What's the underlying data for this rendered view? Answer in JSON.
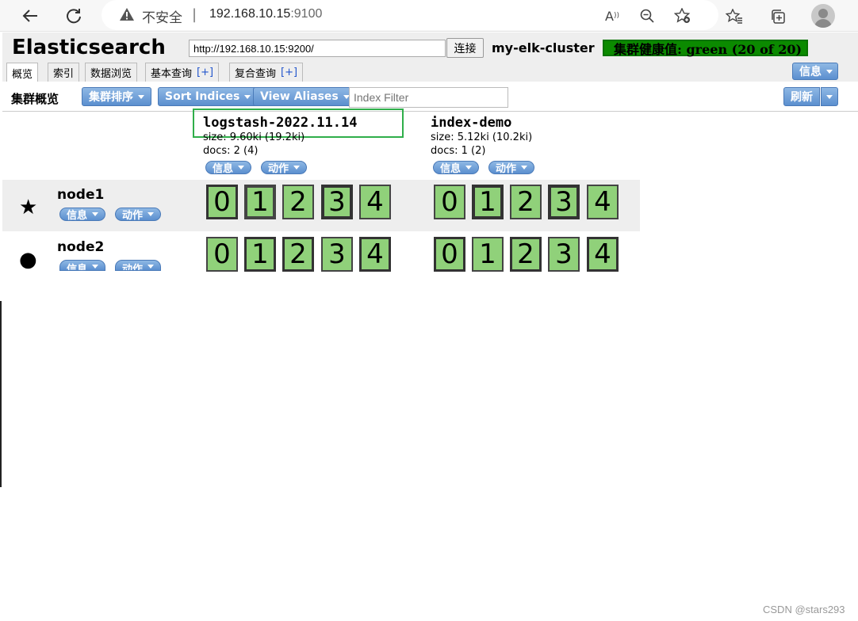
{
  "browser": {
    "insecure_label": "不安全",
    "separator": "|",
    "url_host": "192.168.10.15",
    "url_port": ":9100"
  },
  "header": {
    "logo": "Elasticsearch",
    "connect_url": "http://192.168.10.15:9200/",
    "connect_button": "连接",
    "cluster_name": "my-elk-cluster",
    "health": "集群健康值: green (20 of 20)",
    "health_color": "#0b8a00"
  },
  "tabs": [
    {
      "label": "概览",
      "active": true
    },
    {
      "label": "索引"
    },
    {
      "label": "数据浏览"
    },
    {
      "label": "基本查询",
      "plus": "[+]"
    },
    {
      "label": "复合查询",
      "plus": "[+]"
    }
  ],
  "top_info_button": "信息",
  "toolbar": {
    "title": "集群概览",
    "sort_cluster": "集群排序",
    "sort_indices": "Sort Indices",
    "view_aliases": "View Aliases",
    "filter_placeholder": "Index Filter",
    "refresh": "刷新"
  },
  "indices": [
    {
      "name": "logstash-2022.11.14",
      "size": "size: 9.60ki (19.2ki)",
      "docs": "docs: 2 (4)",
      "info": "信息",
      "action": "动作"
    },
    {
      "name": "index-demo",
      "size": "size: 5.12ki (10.2ki)",
      "docs": "docs: 1 (2)",
      "info": "信息",
      "action": "动作"
    }
  ],
  "nodes": [
    {
      "name": "node1",
      "icon": "star-icon",
      "info": "信息",
      "action": "动作"
    },
    {
      "name": "node2",
      "icon": "circle-icon",
      "info": "信息",
      "action": "动作"
    }
  ],
  "shards": {
    "node1": {
      "logstash": [
        "0",
        "1",
        "2",
        "3",
        "4"
      ],
      "index_demo": [
        "0",
        "1",
        "2",
        "3",
        "4"
      ]
    },
    "node2": {
      "logstash": [
        "0",
        "1",
        "2",
        "3",
        "4"
      ],
      "index_demo": [
        "0",
        "1",
        "2",
        "3",
        "4"
      ]
    }
  },
  "watermark": "CSDN @stars293"
}
